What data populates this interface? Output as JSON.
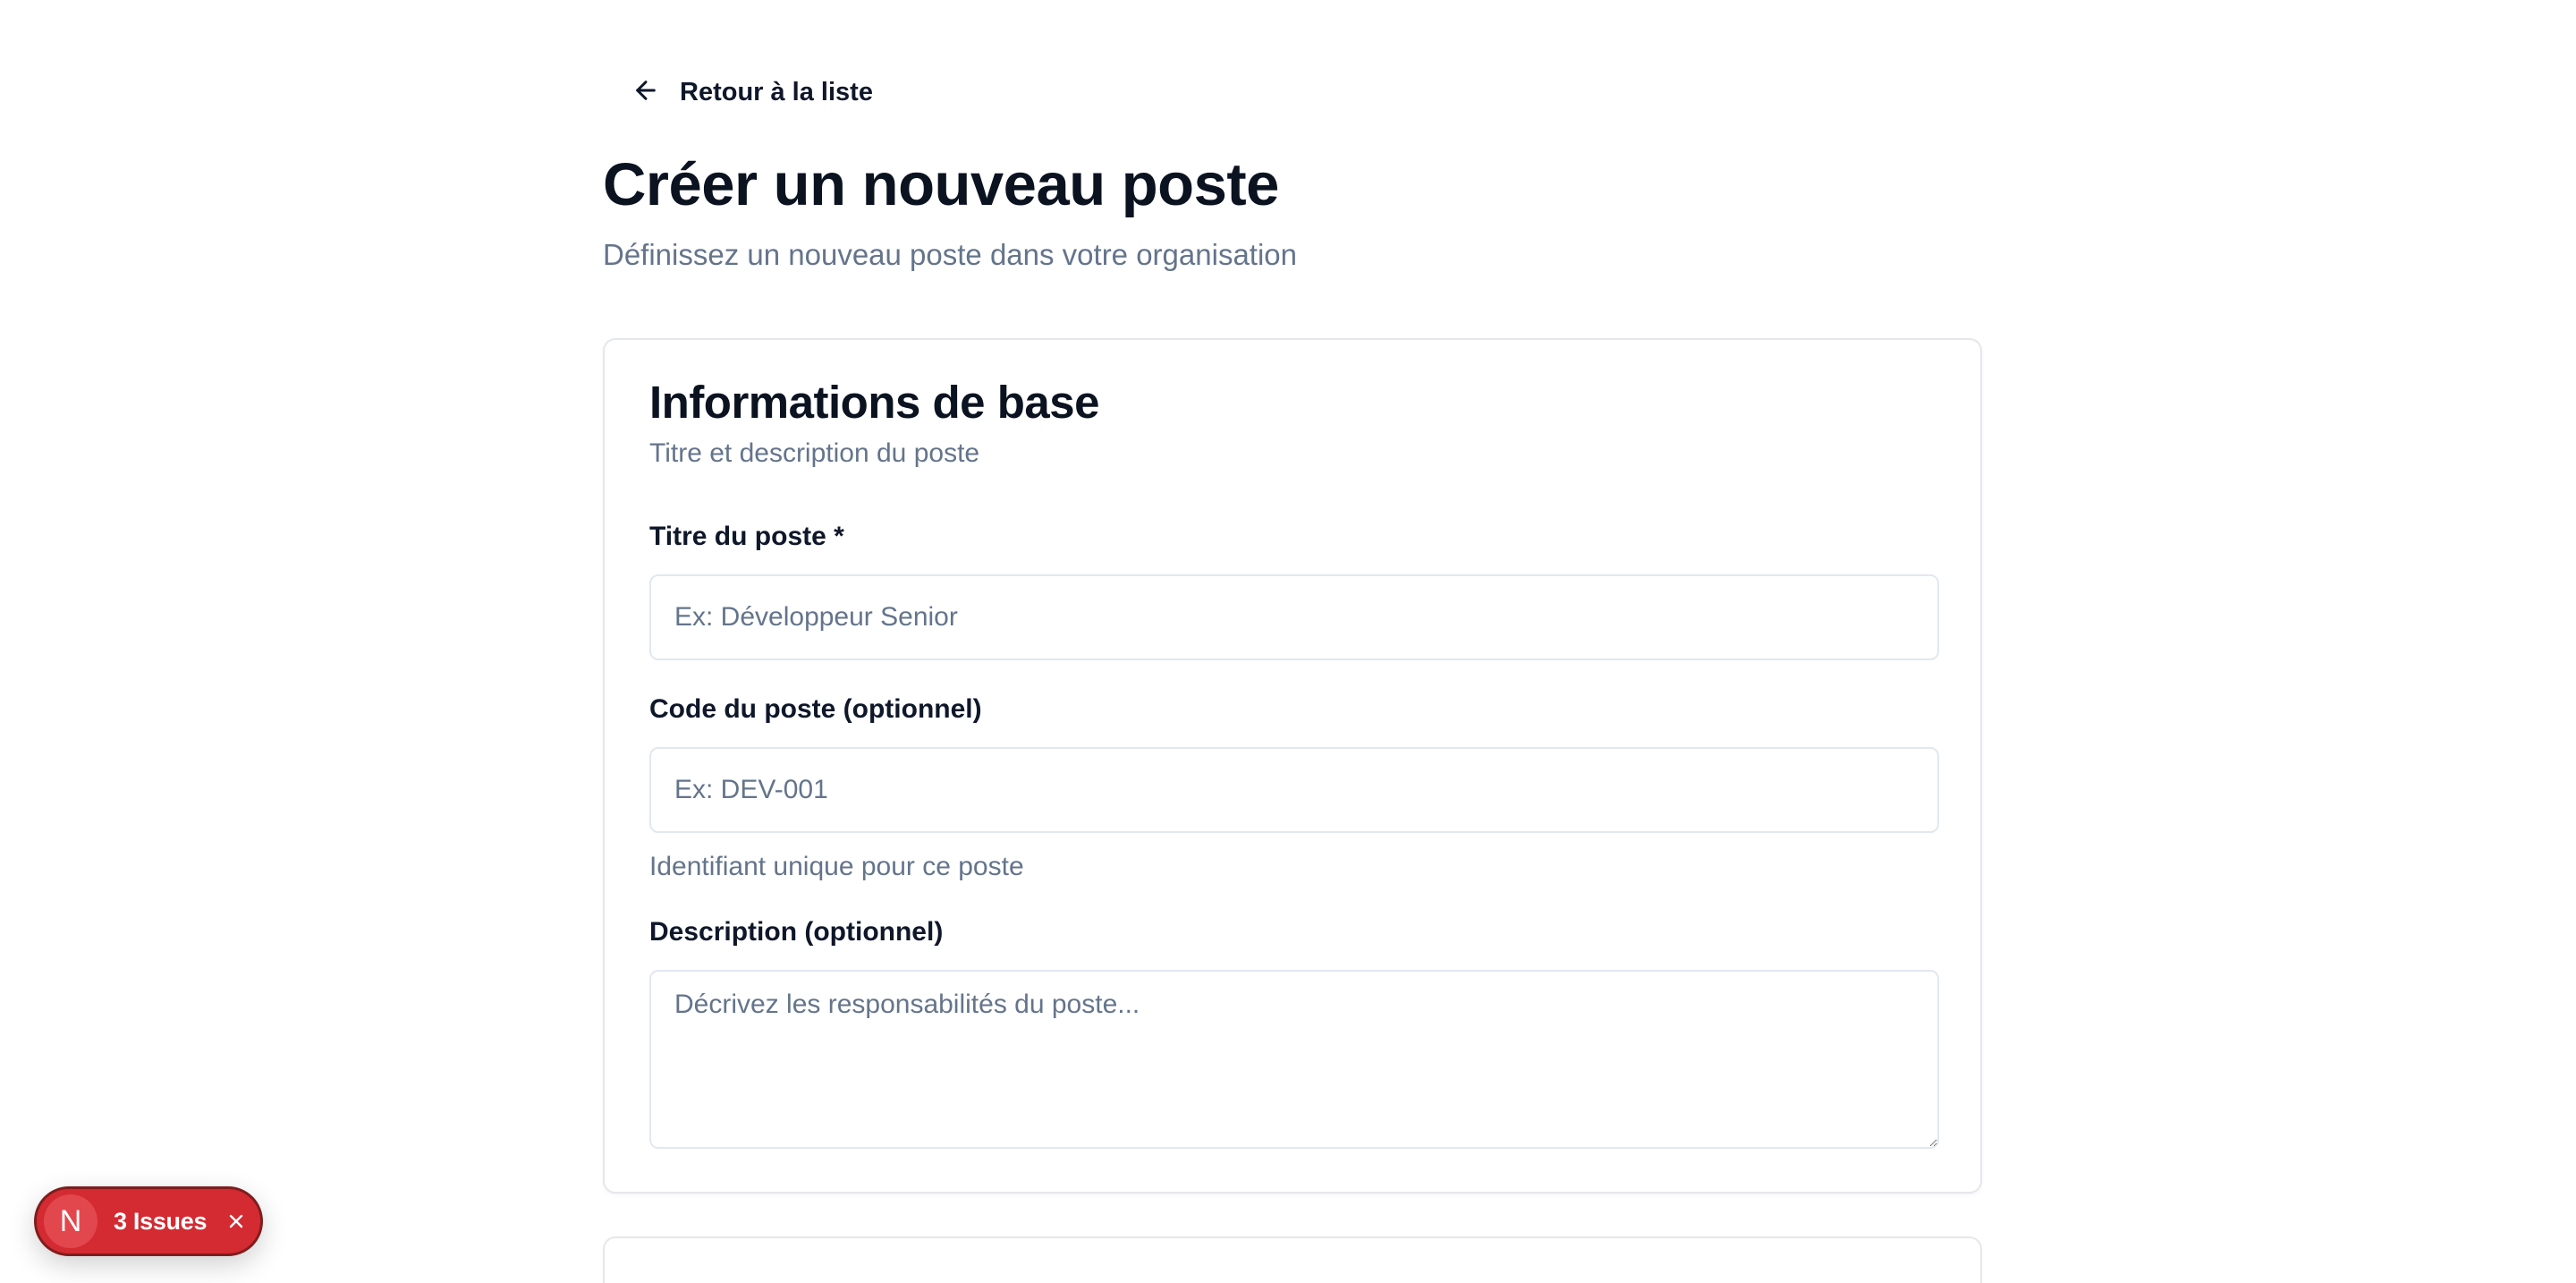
{
  "nav": {
    "back_label": "Retour à la liste",
    "back_icon": "arrow-left-icon"
  },
  "header": {
    "title": "Créer un nouveau poste",
    "subtitle": "Définissez un nouveau poste dans votre organisation"
  },
  "basic_info": {
    "title": "Informations de base",
    "description": "Titre et description du poste",
    "job_title": {
      "label": "Titre du poste *",
      "value": "",
      "placeholder": "Ex: Développeur Senior"
    },
    "job_code": {
      "label": "Code du poste (optionnel)",
      "value": "",
      "placeholder": "Ex: DEV-001",
      "hint": "Identifiant unique pour ce poste"
    },
    "job_description": {
      "label": "Description (optionnel)",
      "value": "",
      "placeholder": "Décrivez les responsabilités du poste..."
    }
  },
  "issues_toast": {
    "logo_letter": "N",
    "label": "3 Issues",
    "close_icon": "close-icon",
    "color": "#d42a32"
  }
}
